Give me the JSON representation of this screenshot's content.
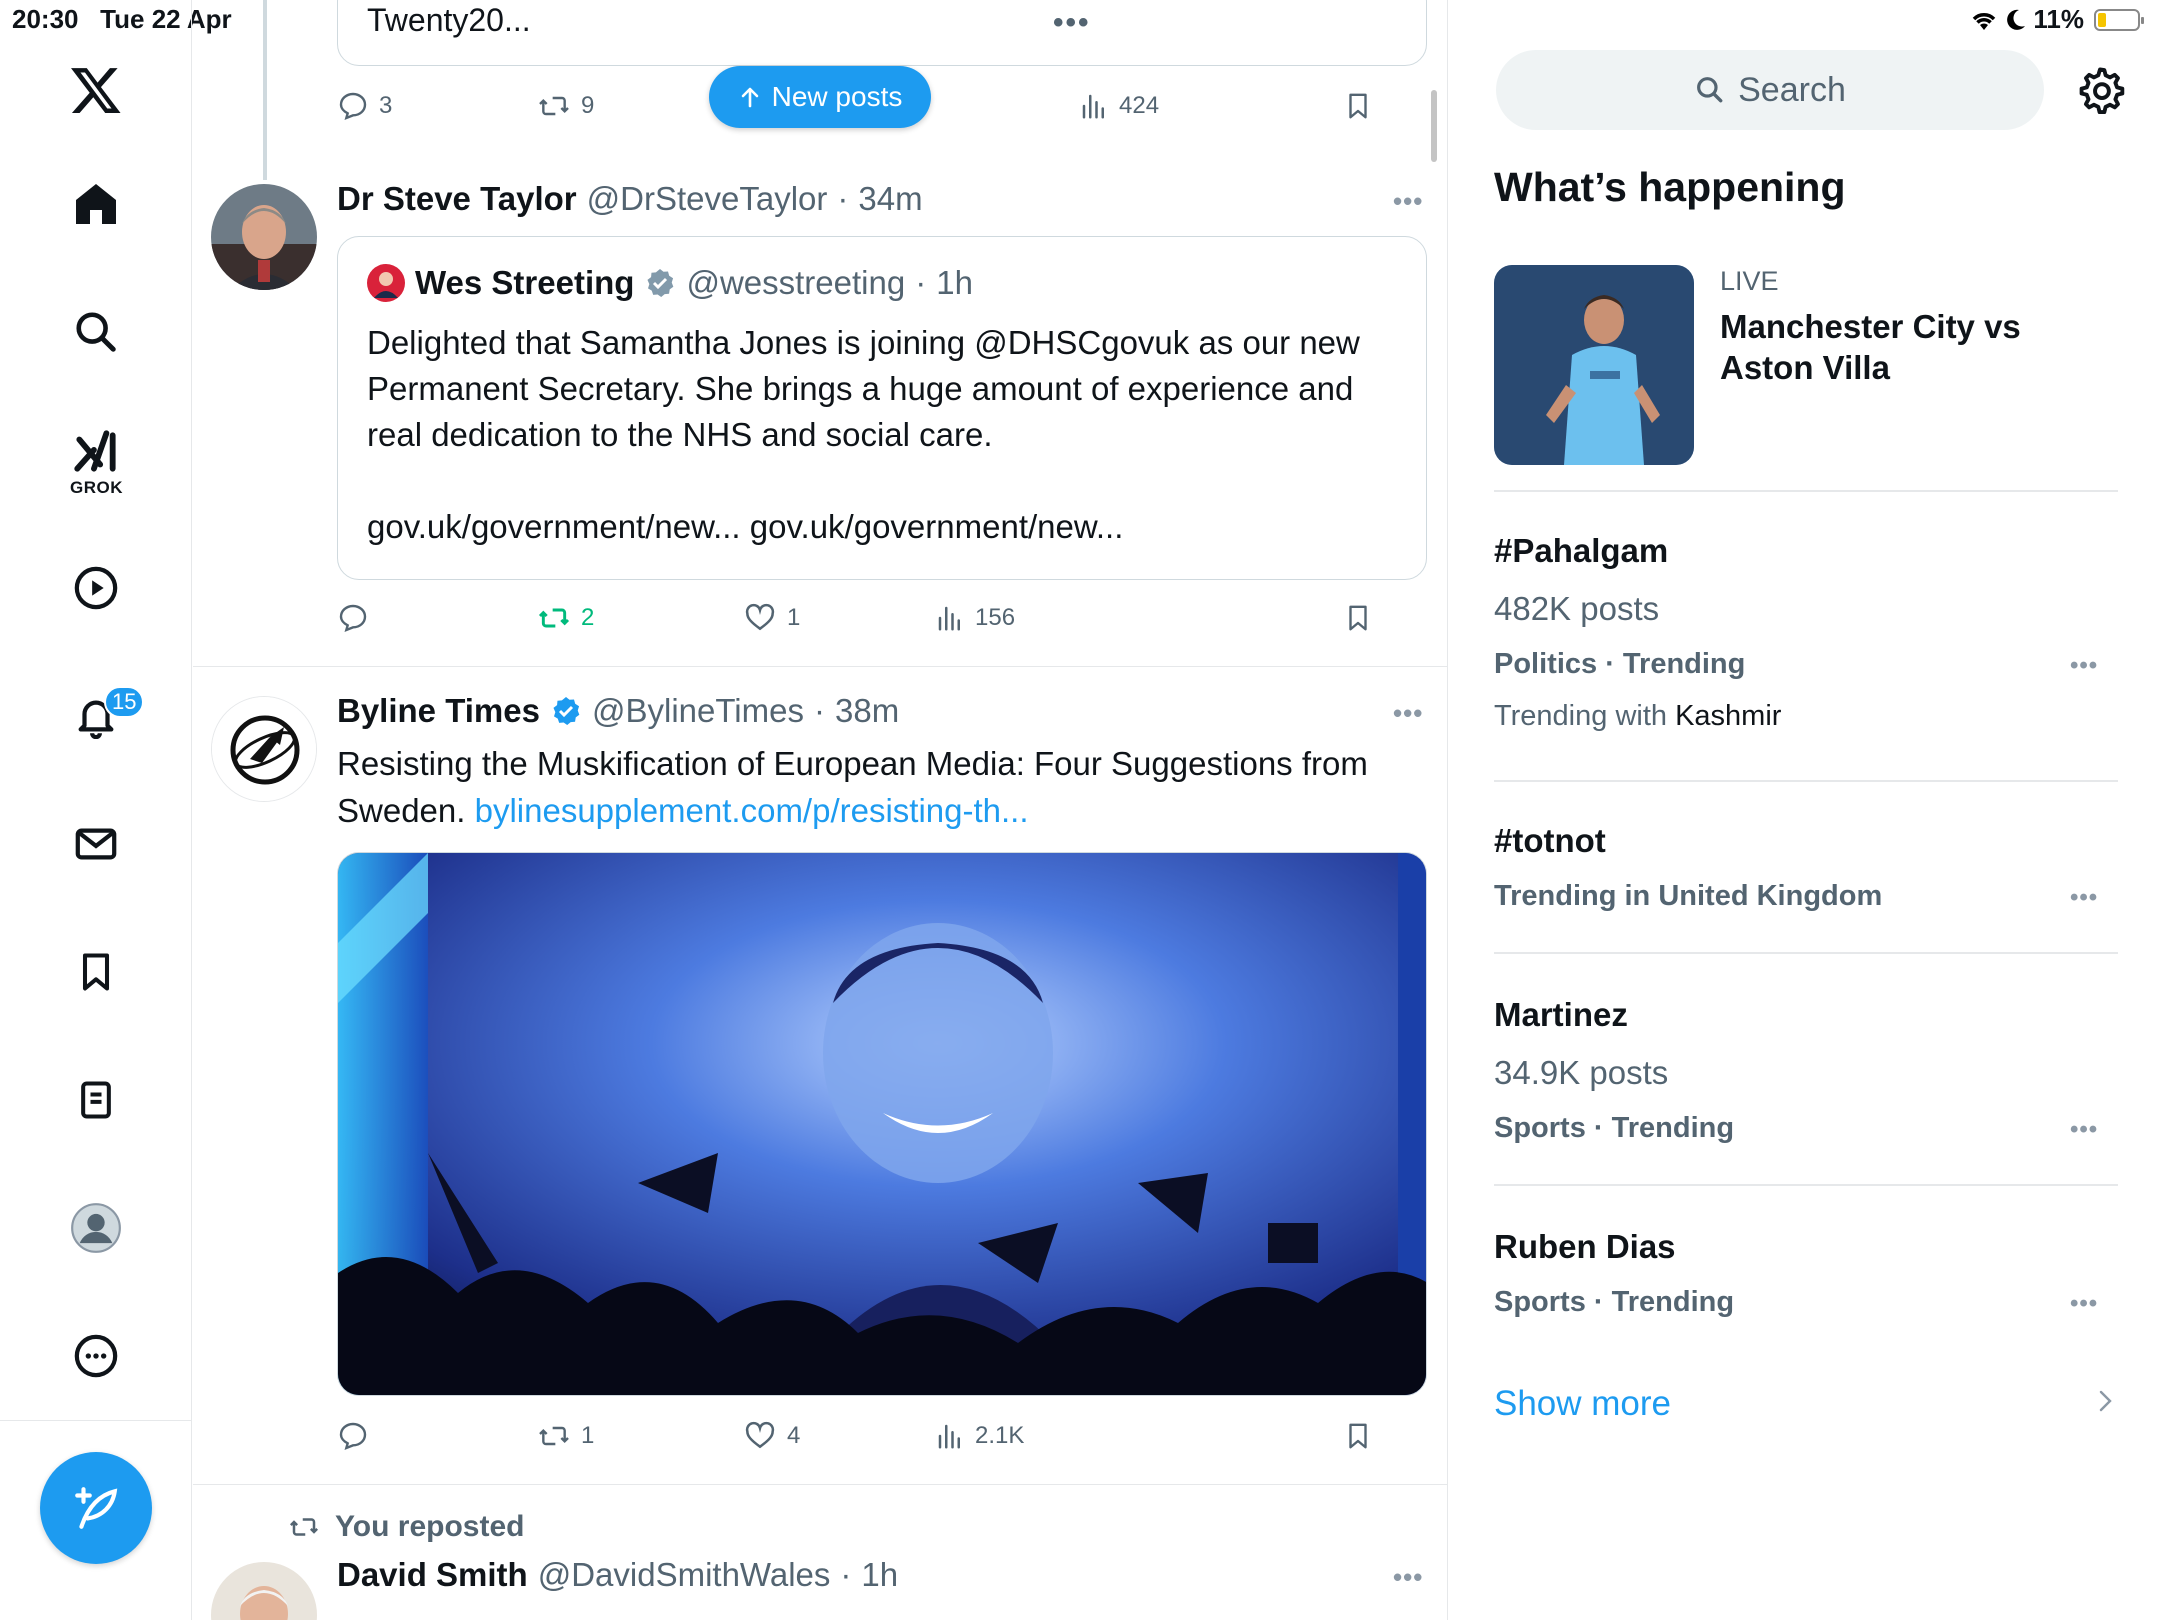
{
  "status_bar": {
    "time": "20:30",
    "date": "Tue 22 Apr",
    "battery": "11%"
  },
  "nav": {
    "grok_label": "GROK",
    "notifications_badge": "15"
  },
  "feed": {
    "new_posts_label": "New posts",
    "top_fragment": {
      "quote_text": "Twenty20...",
      "quote_dots": "•••",
      "actions": {
        "replies": "3",
        "reposts": "9",
        "views": "424"
      }
    },
    "posts": [
      {
        "name": "Dr Steve Taylor",
        "handle": "@DrSteveTaylor",
        "time": "34m",
        "quote": {
          "name": "Wes Streeting",
          "handle": "@wesstreeting",
          "time": "1h",
          "text": "Delighted that Samantha Jones is joining @DHSCgovuk as our new Permanent Secretary. She brings a huge amount of experience and real dedication to the NHS and social care.\n\ngov.uk/government/new... gov.uk/government/new..."
        },
        "actions": {
          "replies": "",
          "reposts": "2",
          "likes": "1",
          "views": "156"
        }
      },
      {
        "name": "Byline Times",
        "handle": "@BylineTimes",
        "time": "38m",
        "text": "Resisting the Muskification of European Media: Four Suggestions from Sweden. ",
        "link": "bylinesupplement.com/p/resisting-th...",
        "actions": {
          "replies": "",
          "reposts": "1",
          "likes": "4",
          "views": "2.1K"
        }
      },
      {
        "repost_label": "You reposted",
        "name": "David Smith",
        "handle": "@DavidSmithWales",
        "time": "1h"
      }
    ]
  },
  "sidebar": {
    "search_placeholder": "Search",
    "section_title": "What’s happening",
    "live": {
      "tag": "LIVE",
      "title": "Manchester City vs Aston Villa"
    },
    "trends": [
      {
        "title": "#Pahalgam",
        "count": "482K posts",
        "category": "Politics · Trending",
        "with_label": "Trending with",
        "with_value": "Kashmir"
      },
      {
        "title": "#totnot",
        "category": "Trending in United Kingdom"
      },
      {
        "title": "Martinez",
        "count": "34.9K posts",
        "category": "Sports · Trending"
      },
      {
        "title": "Ruben Dias",
        "category": "Sports · Trending"
      }
    ],
    "show_more": "Show more"
  },
  "colors": {
    "accent": "#1d9bf0",
    "repost_green": "#00ba7c",
    "muted": "#536471"
  }
}
